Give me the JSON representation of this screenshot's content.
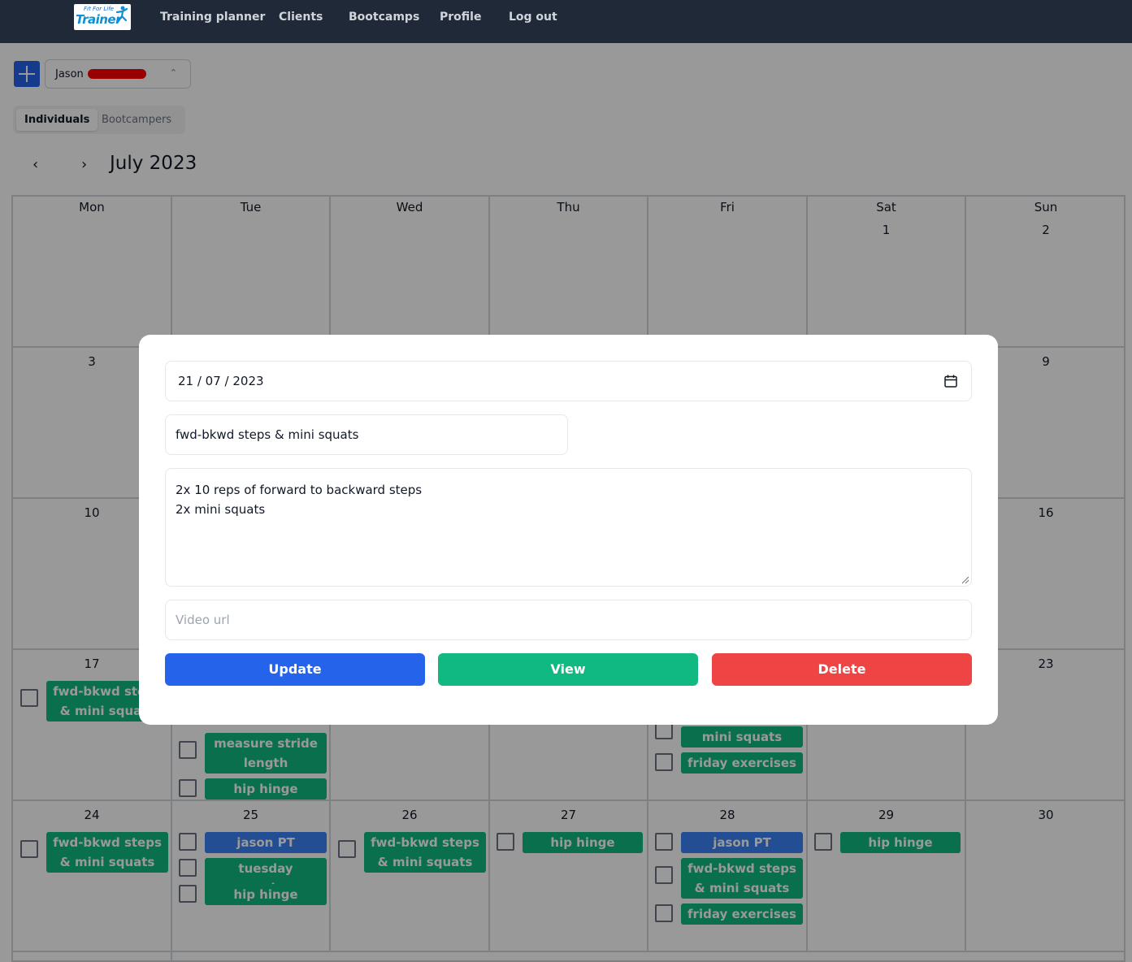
{
  "nav": {
    "logo_line1": "Fit For Life",
    "logo_line2": "Trainer",
    "links": [
      "Training planner",
      "Clients",
      "Bootcamps",
      "Profile",
      "Log out"
    ]
  },
  "controls": {
    "client_name": "Jason",
    "segments": [
      "Individuals",
      "Bootcampers"
    ],
    "active_segment": "Individuals",
    "prev_icon": "‹",
    "next_icon": "›",
    "month_title": "July 2023"
  },
  "calendar": {
    "weekdays": [
      "Mon",
      "Tue",
      "Wed",
      "Thu",
      "Fri",
      "Sat",
      "Sun"
    ],
    "days": {
      "d1": "1",
      "d2": "2",
      "d3": "3",
      "d9": "9",
      "d10": "10",
      "d16": "16",
      "d17": "17",
      "d23": "23",
      "d24": "24",
      "d25": "25",
      "d26": "26",
      "d27": "27",
      "d28": "28",
      "d29": "29",
      "d30": "30"
    },
    "events": {
      "mon17": "fwd-bkwd steps & mini squats",
      "tue_measure": "measure stride length",
      "tue_hip": "hip hinge",
      "fri_squats": "mini squats",
      "fri_exercises": "friday exercises",
      "mon24": "fwd-bkwd steps & mini squats",
      "tue25_pt": "jason PT",
      "tue25_ex": "tuesday exercises",
      "tue25_hip": "hip hinge",
      "wed26": "fwd-bkwd steps & mini squats",
      "thu27": "hip hinge",
      "fri28_pt": "jason PT",
      "fri28_steps": "fwd-bkwd steps & mini squats",
      "fri28_ex": "friday exercises",
      "sat29": "hip hinge"
    }
  },
  "modal": {
    "date_value": "21 / 07 / 2023",
    "title_value": "fwd-bkwd steps & mini squats",
    "notes_line1": "2x 10 reps of forward to backward steps",
    "notes_line2": "2x mini squats",
    "video_placeholder": "Video url",
    "update_label": "Update",
    "view_label": "View",
    "delete_label": "Delete"
  },
  "colors": {
    "nav_bg": "#1f2937",
    "primary": "#2563eb",
    "success": "#10b981",
    "danger": "#ef4444",
    "event_blue": "#3b82f6"
  },
  "icons": [
    "plus-icon",
    "chevron-updown-icon",
    "chevron-left-icon",
    "chevron-right-icon",
    "calendar-icon",
    "resize-grip-icon"
  ]
}
